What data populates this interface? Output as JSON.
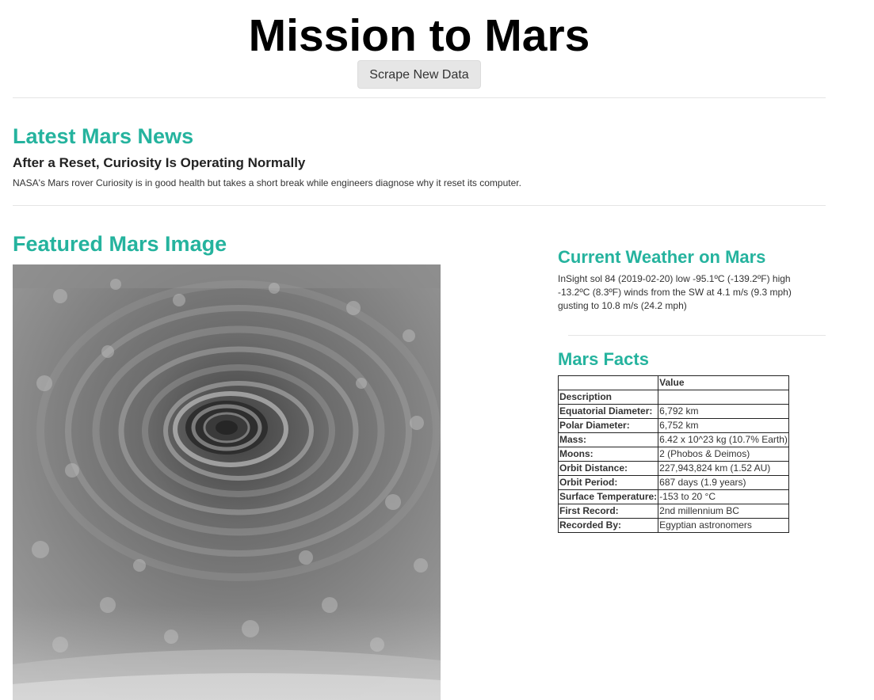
{
  "header": {
    "title": "Mission to Mars",
    "scrape_button": "Scrape New Data"
  },
  "news": {
    "heading": "Latest Mars News",
    "title": "After a Reset, Curiosity Is Operating Normally",
    "teaser": "NASA's Mars rover Curiosity is in good health but takes a short break while engineers diagnose why it reset its computer."
  },
  "featured": {
    "heading": "Featured Mars Image"
  },
  "weather": {
    "heading": "Current Weather on Mars",
    "text": "InSight sol 84 (2019-02-20) low -95.1ºC (-139.2ºF) high -13.2ºC (8.3ºF) winds from the SW at 4.1 m/s (9.3 mph) gusting to 10.8 m/s (24.2 mph)"
  },
  "facts": {
    "heading": "Mars Facts",
    "columns": [
      "",
      "Value"
    ],
    "index_name": "Description",
    "rows": [
      {
        "label": "Equatorial Diameter:",
        "value": "6,792 km"
      },
      {
        "label": "Polar Diameter:",
        "value": "6,752 km"
      },
      {
        "label": "Mass:",
        "value": "6.42 x 10^23 kg (10.7% Earth)"
      },
      {
        "label": "Moons:",
        "value": "2 (Phobos & Deimos)"
      },
      {
        "label": "Orbit Distance:",
        "value": "227,943,824 km (1.52 AU)"
      },
      {
        "label": "Orbit Period:",
        "value": "687 days (1.9 years)"
      },
      {
        "label": "Surface Temperature:",
        "value": "-153 to 20 °C"
      },
      {
        "label": "First Record:",
        "value": "2nd millennium BC"
      },
      {
        "label": "Recorded By:",
        "value": "Egyptian astronomers"
      }
    ]
  },
  "colors": {
    "heading_accent": "#25b39e",
    "button_bg": "#e6e6e6"
  }
}
